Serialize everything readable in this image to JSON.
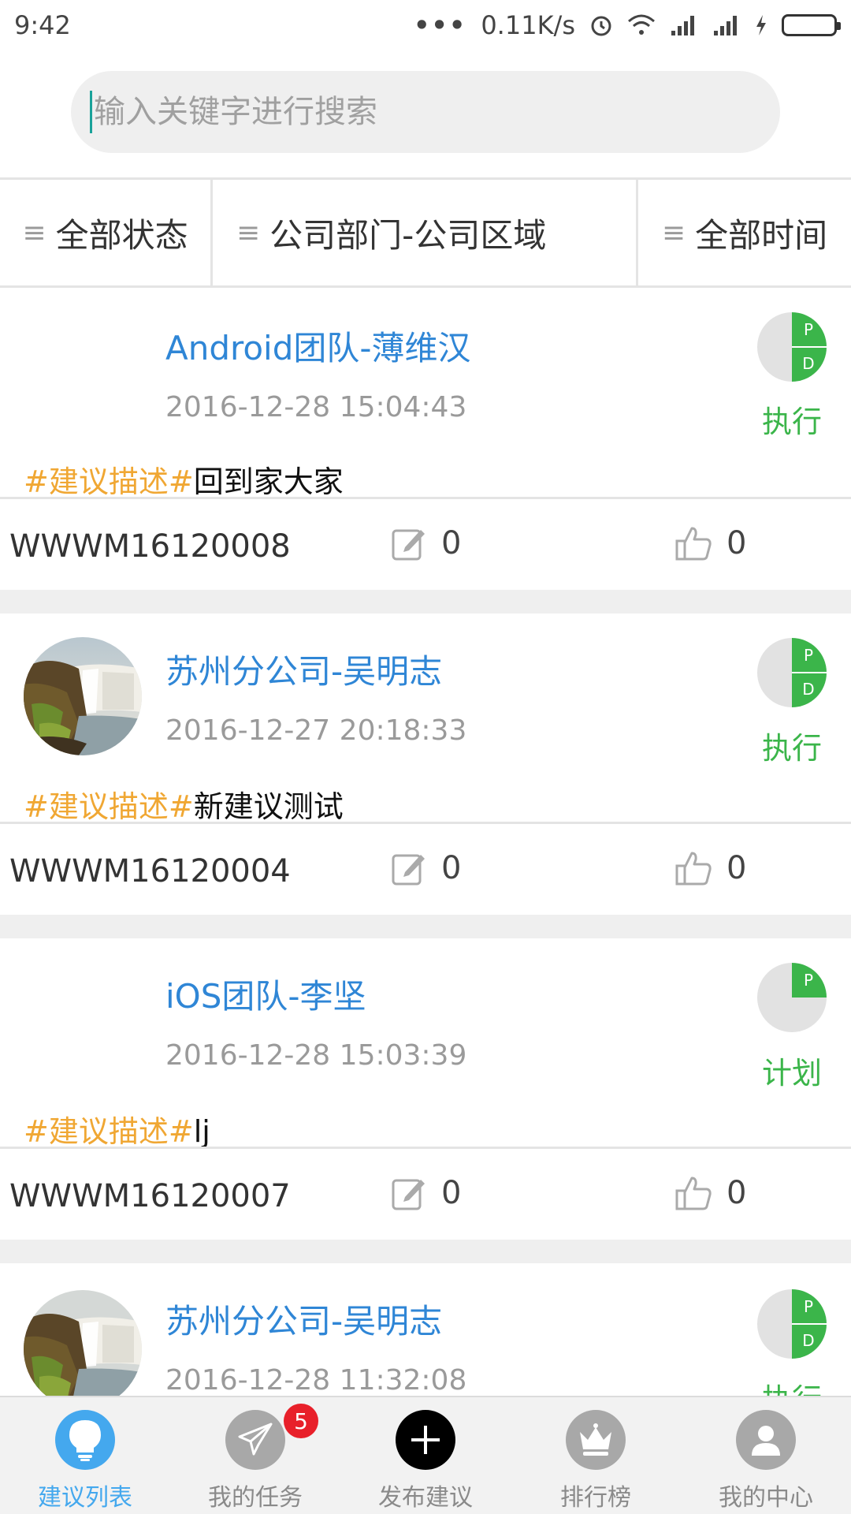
{
  "status_bar": {
    "time": "9:42",
    "dots": "•••",
    "net_speed": "0.11K/s"
  },
  "search": {
    "placeholder": "输入关键字进行搜索"
  },
  "filters": [
    {
      "label": "全部状态"
    },
    {
      "label": "公司部门-公司区域"
    },
    {
      "label": "全部时间"
    }
  ],
  "menu_glyph": "≡",
  "cards": [
    {
      "author": "Android团队-薄维汉",
      "datetime": "2016-12-28 15:04:43",
      "status_label": "执行",
      "status_letters": [
        "P",
        "D"
      ],
      "desc_tag": "#建议描述#",
      "desc_text": "回到家大家",
      "code": "WWWM16120008",
      "comments": "0",
      "likes": "0",
      "has_avatar": false
    },
    {
      "author": "苏州分公司-吴明志",
      "datetime": "2016-12-27 20:18:33",
      "status_label": "执行",
      "status_letters": [
        "P",
        "D"
      ],
      "desc_tag": "#建议描述#",
      "desc_text": "新建议测试",
      "code": "WWWM16120004",
      "comments": "0",
      "likes": "0",
      "has_avatar": true
    },
    {
      "author": "iOS团队-李坚",
      "datetime": "2016-12-28 15:03:39",
      "status_label": "计划",
      "status_letters": [
        "P"
      ],
      "desc_tag": "#建议描述#",
      "desc_text": "lj",
      "code": "WWWM16120007",
      "comments": "0",
      "likes": "0",
      "has_avatar": false
    },
    {
      "author": "苏州分公司-吴明志",
      "datetime": "2016-12-28 11:32:08",
      "status_label": "执行",
      "status_letters": [
        "P",
        "D"
      ],
      "has_avatar": true
    }
  ],
  "bottom_nav": [
    {
      "label": "建议列表",
      "icon": "lightbulb-icon",
      "active": true
    },
    {
      "label": "我的任务",
      "icon": "paper-plane-icon",
      "badge": "5"
    },
    {
      "label": "发布建议",
      "icon": "plus-icon"
    },
    {
      "label": "排行榜",
      "icon": "crown-icon"
    },
    {
      "label": "我的中心",
      "icon": "user-icon"
    }
  ],
  "colors": {
    "accent_blue": "#2f86d6",
    "status_green": "#3bb54a",
    "tag_orange": "#f0a733",
    "badge_red": "#e8202a"
  }
}
